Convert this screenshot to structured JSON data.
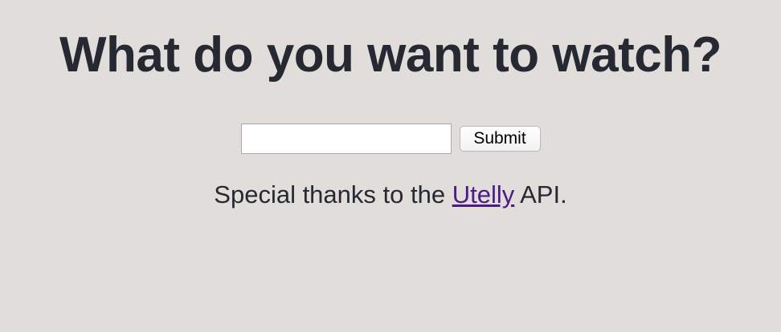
{
  "page": {
    "title": "What do you want to watch?"
  },
  "search": {
    "value": "",
    "placeholder": "",
    "submit_label": "Submit"
  },
  "credits": {
    "prefix": "Special thanks to the ",
    "link_text": "Utelly",
    "suffix": " API."
  },
  "colors": {
    "background": "#e0dddb",
    "text": "#262931",
    "link": "#4c1c84"
  }
}
